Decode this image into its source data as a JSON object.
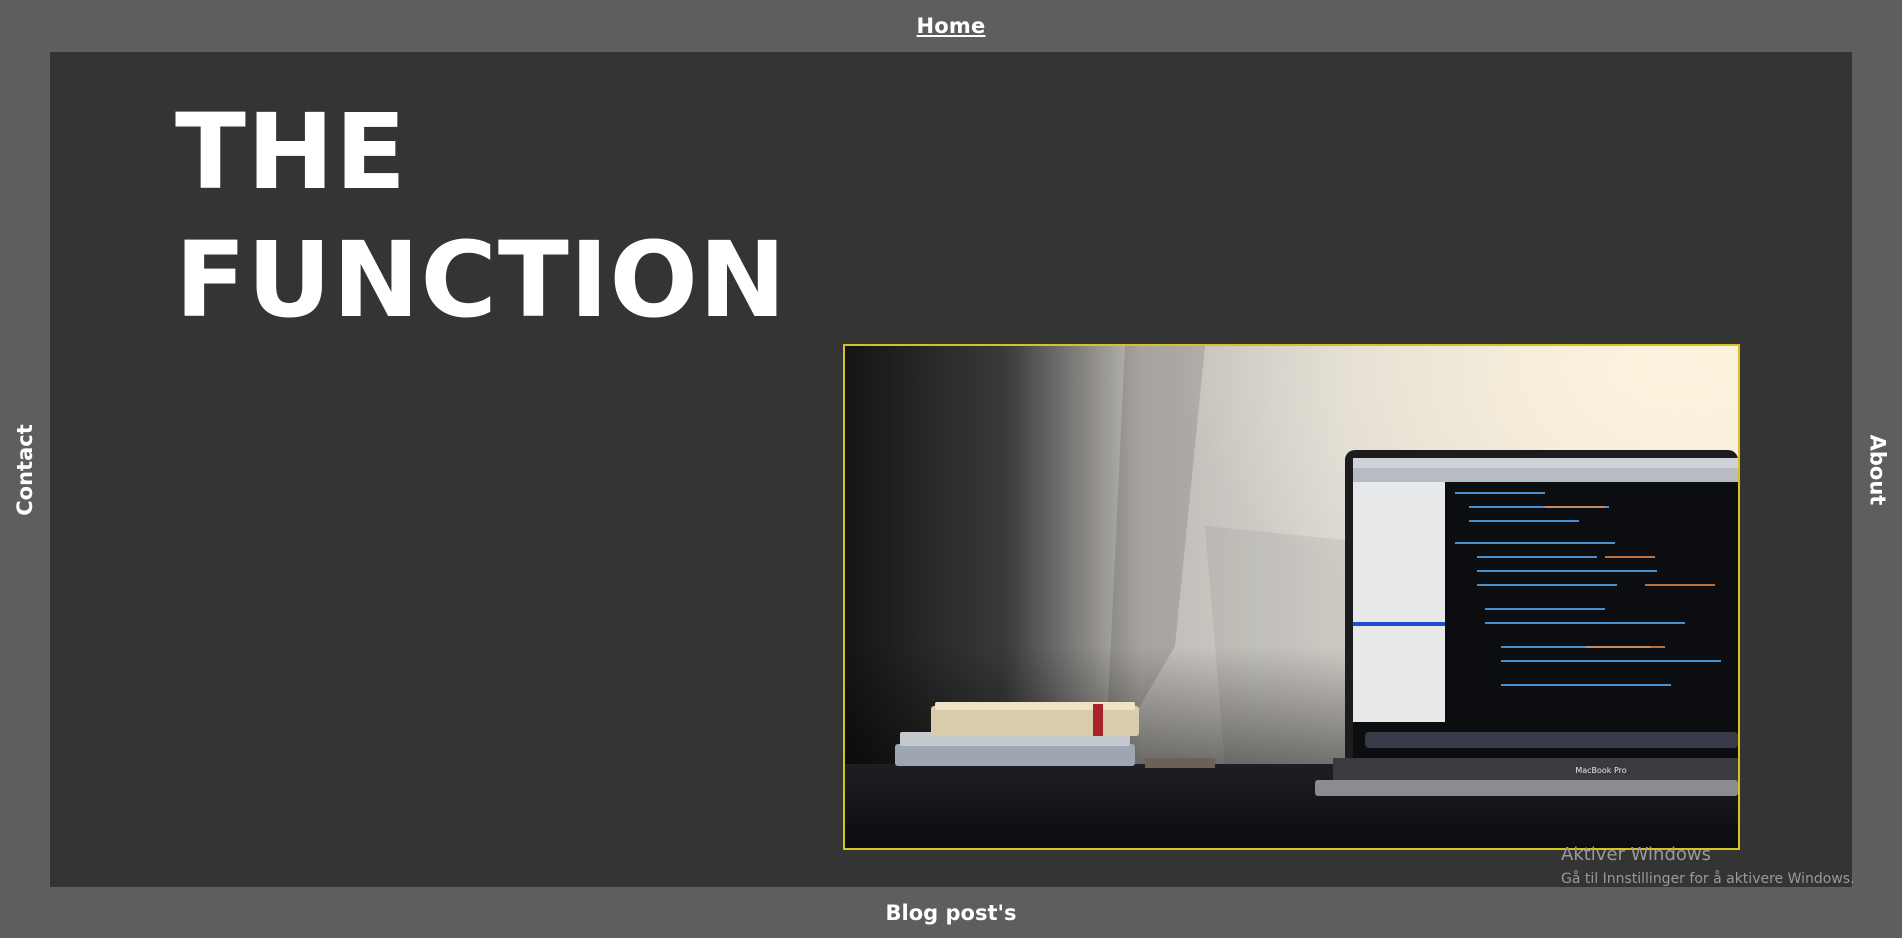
{
  "nav": {
    "top": "Home",
    "bottom": "Blog post's",
    "left": "Contact",
    "right": "About"
  },
  "hero": {
    "title_line1": "THE",
    "title_line2": "FUNCTION",
    "laptop_label": "MacBook Pro"
  },
  "colors": {
    "page_bg": "#5e5e5e",
    "main_bg": "#343434",
    "image_border": "#d6c31e",
    "text": "#ffffff"
  },
  "os_watermark": {
    "title": "Aktiver Windows",
    "subtitle": "Gå til Innstillinger for å aktivere Windows."
  }
}
